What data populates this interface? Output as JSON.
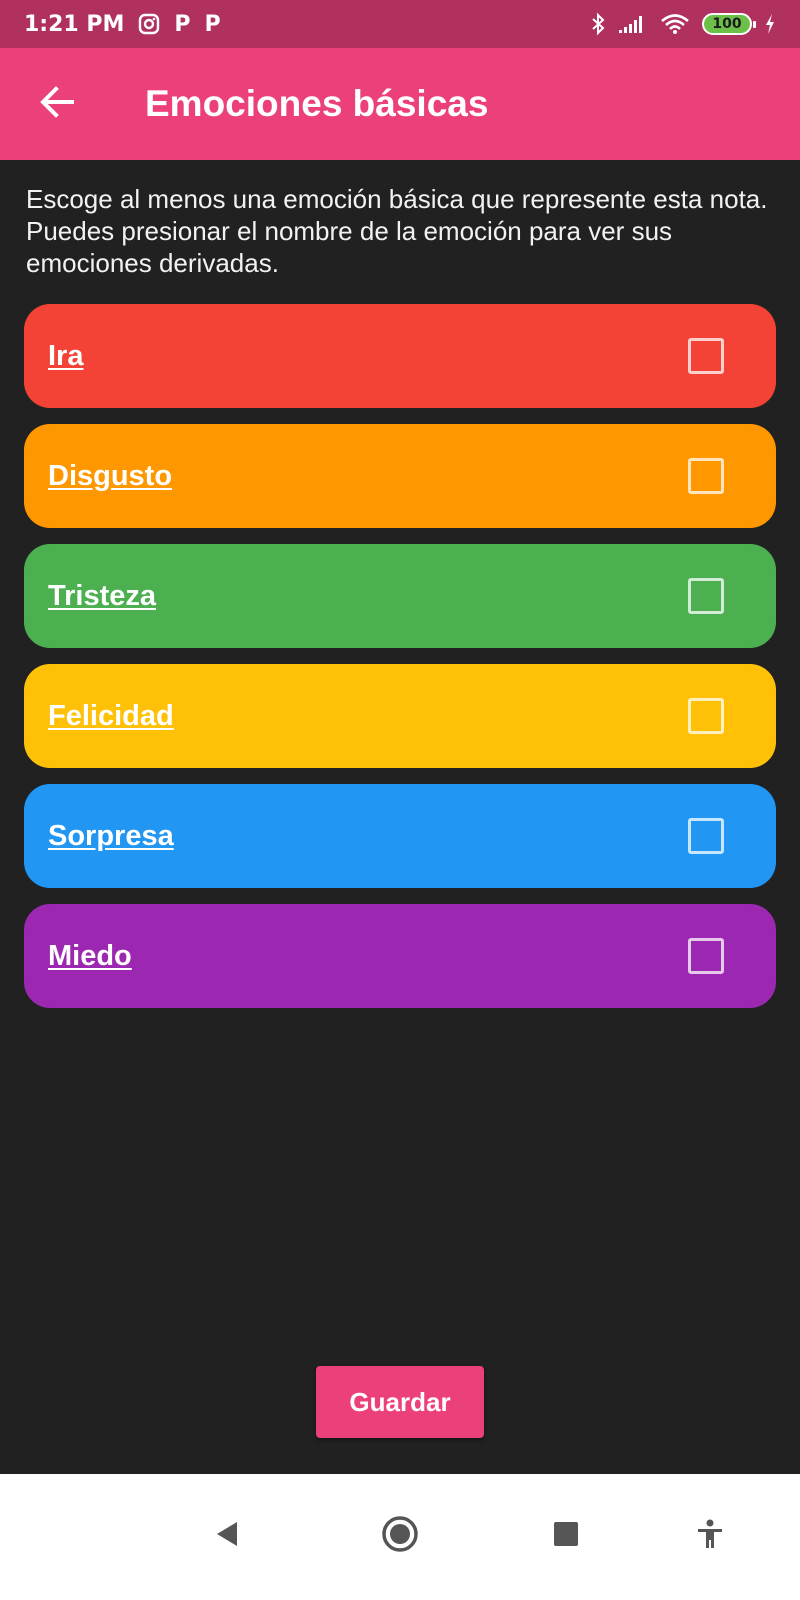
{
  "status_bar": {
    "time": "1:21 PM",
    "left_icons": [
      "instagram-icon",
      "p-icon",
      "p-icon"
    ],
    "right_icons": [
      "bluetooth-icon",
      "signal-icon",
      "wifi-icon",
      "battery-icon",
      "charging-icon"
    ],
    "battery_level": "100",
    "p_glyph": "P"
  },
  "app_bar": {
    "title": "Emociones básicas",
    "back_icon": "arrow-back-icon",
    "color": "#ec407a"
  },
  "description": "Escoge al menos una emoción básica que represente esta nota. Puedes presionar el nombre de la emoción para ver sus emociones derivadas.",
  "emotions": [
    {
      "name": "Ira",
      "color": "#f44336",
      "checked": false
    },
    {
      "name": "Disgusto",
      "color": "#ff9800",
      "checked": false
    },
    {
      "name": "Tristeza",
      "color": "#4caf50",
      "checked": false
    },
    {
      "name": "Felicidad",
      "color": "#ffc107",
      "checked": false
    },
    {
      "name": "Sorpresa",
      "color": "#2196f3",
      "checked": false
    },
    {
      "name": "Miedo",
      "color": "#9c27b0",
      "checked": false
    }
  ],
  "save_button": {
    "label": "Guardar"
  },
  "nav_bar": {
    "icons": [
      "back-triangle-icon",
      "home-circle-icon",
      "recents-square-icon",
      "accessibility-icon"
    ]
  }
}
